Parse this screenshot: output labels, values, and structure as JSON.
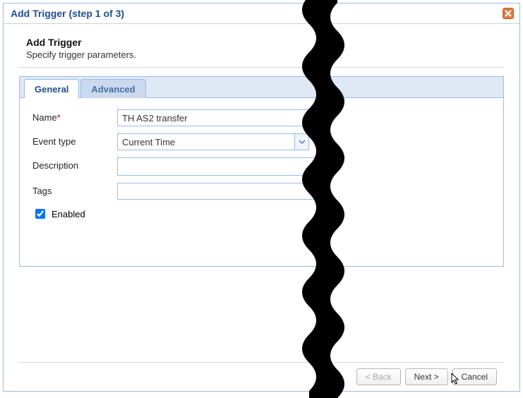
{
  "titlebar": {
    "title": "Add Trigger (step 1 of 3)"
  },
  "header": {
    "title": "Add Trigger",
    "subtitle": "Specify trigger parameters."
  },
  "tabs": [
    {
      "label": "General",
      "active": true
    },
    {
      "label": "Advanced",
      "active": false
    }
  ],
  "form": {
    "name": {
      "label": "Name",
      "required_mark": "*",
      "value": "TH AS2 transfer"
    },
    "event_type": {
      "label": "Event type",
      "value": "Current Time"
    },
    "description": {
      "label": "Description",
      "value": ""
    },
    "tags": {
      "label": "Tags",
      "value": ""
    },
    "enabled": {
      "label": "Enabled",
      "checked": true
    }
  },
  "footer": {
    "back": "< Back",
    "next": "Next >",
    "cancel": "Cancel"
  },
  "help_icon_label": "?"
}
